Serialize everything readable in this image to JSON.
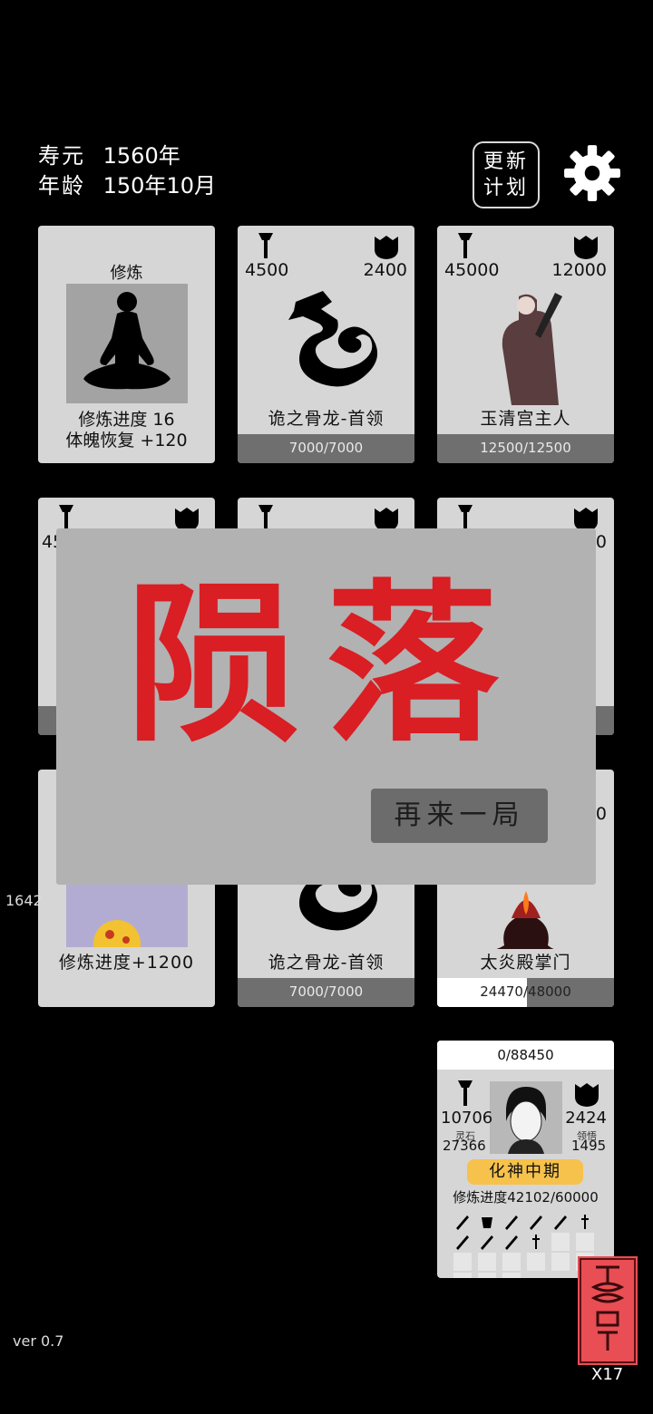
{
  "hud": {
    "lifespan_label": "寿元",
    "lifespan_value": "1560年",
    "age_label": "年龄",
    "age_value": "150年10月"
  },
  "plan_button": {
    "line1": "更新",
    "line2": "计划"
  },
  "meditation": {
    "title": "修炼",
    "progress": "修炼进度 16",
    "recovery": "体魄恢复 +120"
  },
  "cards": [
    {
      "atk": "4500",
      "def": "2400",
      "name": "诡之骨龙-首领",
      "hp": "7000/7000",
      "hp_fraction": 1.0
    },
    {
      "atk": "45000",
      "def": "12000",
      "name": "玉清宫主人",
      "hp": "12500/12500",
      "hp_fraction": 1.0
    },
    {
      "atk": "45",
      "def": ""
    },
    {
      "atk": "",
      "def": ""
    },
    {
      "atk": "",
      "def": "0"
    },
    {
      "name": "修炼进度+1200"
    },
    {
      "name": "诡之骨龙-首领",
      "hp": "7000/7000",
      "hp_fraction": 1.0
    },
    {
      "def": "0",
      "name": "太炎殿掌门",
      "hp": "24470/48000",
      "hp_fraction": 0.51
    }
  ],
  "side_number": "1642",
  "overlay": {
    "title": "陨落",
    "retry_label": "再来一局"
  },
  "player": {
    "xp": "0/88450",
    "atk": "10706",
    "def": "2424",
    "spirit_stone_label": "灵石",
    "spirit_stone": "27366",
    "insight_label": "领悟",
    "insight": "1495",
    "realm": "化神中期",
    "progress": "修炼进度42102/60000"
  },
  "talisman": {
    "count": "X17"
  },
  "version": "ver 0.7",
  "colors": {
    "death_text": "#d91e24",
    "realm_badge": "#f6c24b",
    "talisman": "#e84e53"
  }
}
